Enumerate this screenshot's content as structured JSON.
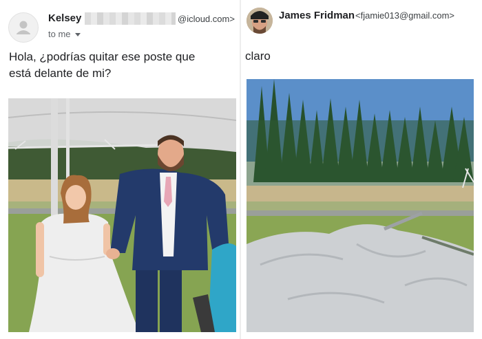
{
  "left_email": {
    "sender_name": "Kelsey",
    "sender_email": "@icloud.com>",
    "to_label": "to me",
    "body_line1": "Hola, ¿podrías quitar ese poste que",
    "body_line2": "está delante de mi?"
  },
  "right_email": {
    "sender_name": "James Fridman",
    "sender_email": "<fjamie013@gmail.com>",
    "body": "claro"
  },
  "icons": {
    "left_avatar": "person-icon",
    "right_avatar": "profile-photo",
    "dropdown": "chevron-down-icon"
  },
  "colors": {
    "suit": "#233a6b",
    "tent": "#d9d9d9",
    "grass": "#86a452",
    "sky": "#5b8fc9",
    "tie": "#e7a6b6"
  }
}
